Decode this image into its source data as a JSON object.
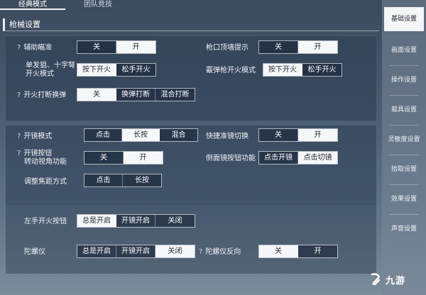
{
  "tabs": [
    "经典模式",
    "团队竞技"
  ],
  "section_title": "枪械设置",
  "sidebar": [
    {
      "label": "基础设置",
      "active": true
    },
    {
      "label": "画面设置"
    },
    {
      "label": "操作设置"
    },
    {
      "label": "载具设置"
    },
    {
      "label": "灵敏度设置"
    },
    {
      "label": "拾取设置"
    },
    {
      "label": "效果设置"
    },
    {
      "label": "声音设置"
    }
  ],
  "settings": {
    "aim_assist": {
      "label": "辅助瞄准",
      "has_help": true,
      "options": [
        "关",
        "开"
      ],
      "selected": 1
    },
    "muzzle_wall": {
      "label": "枪口顶墙提示",
      "options": [
        "关",
        "开"
      ],
      "selected": 1
    },
    "single_fire_mode": {
      "label_line1": "单发狙、十字弩",
      "label_line2": "开火模式",
      "options": [
        "按下开火",
        "松手开火"
      ],
      "selected": 0
    },
    "shotgun_fire_mode": {
      "label": "霰弹枪开火模式",
      "options": [
        "按下开火",
        "松手开火"
      ],
      "selected": 0
    },
    "fire_interrupt_reload": {
      "label": "开火打断换弹",
      "has_help": true,
      "options": [
        "关",
        "换弹打断",
        "混合打断"
      ],
      "selected": 0
    },
    "scope_mode": {
      "label": "开镜模式",
      "has_help": true,
      "options": [
        "点击",
        "长按",
        "混合"
      ],
      "selected": 1
    },
    "quick_scope_switch": {
      "label": "快捷准镜切换",
      "options": [
        "关",
        "开"
      ],
      "selected": 1
    },
    "scope_button_rotate": {
      "label_line1": "开镜按钮",
      "label_line2": "转动视角功能",
      "has_help": true,
      "options": [
        "关",
        "开"
      ],
      "selected": 1
    },
    "side_scope_button": {
      "label": "侧面镜按钮功能",
      "options": [
        "点击开镜",
        "点击切镜"
      ],
      "selected": 1
    },
    "focus_adjust": {
      "label": "调整焦距方式",
      "options": [
        "点击",
        "长按"
      ],
      "selected": 0
    },
    "left_fire_button": {
      "label": "左手开火按钮",
      "options": [
        "总是开启",
        "开镜开启",
        "关闭"
      ],
      "selected": 0
    },
    "gyroscope": {
      "label": "陀螺仪",
      "options": [
        "总是开启",
        "开镜开启",
        "关闭"
      ],
      "selected": 2
    },
    "gyro_reverse": {
      "label": "陀螺仪反向",
      "has_help": true,
      "options": [
        "关",
        "开"
      ],
      "selected": 0
    }
  },
  "help_glyph": "?",
  "watermark": {
    "text": "九游",
    "icon": "jiuyou-logo-icon"
  }
}
